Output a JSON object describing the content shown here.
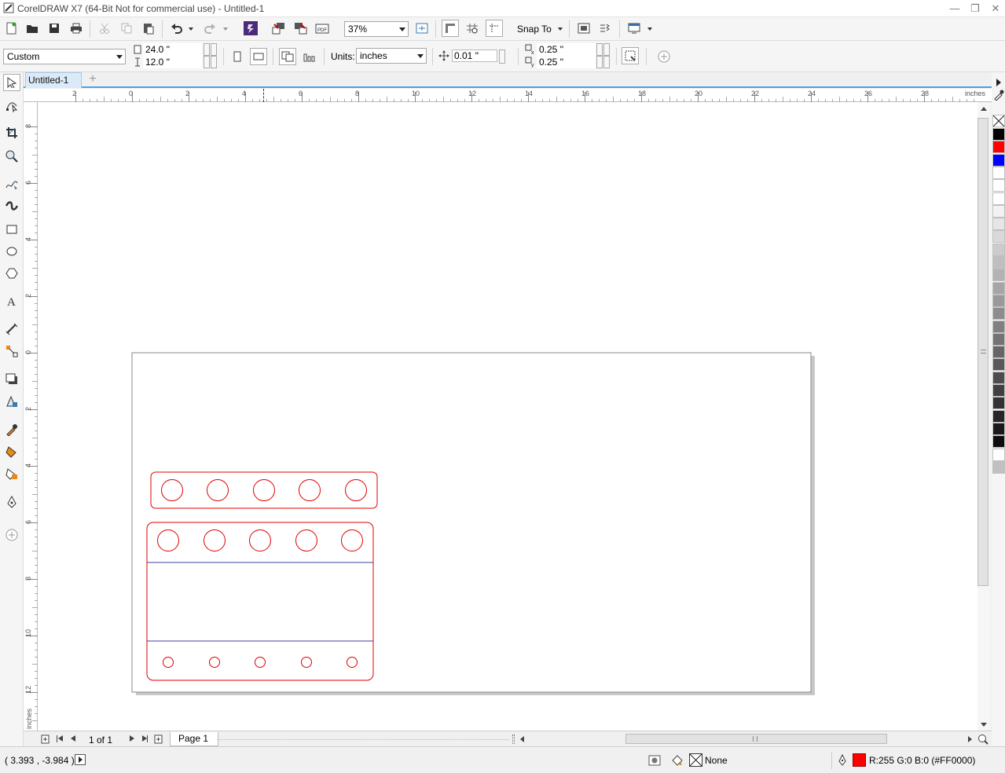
{
  "window": {
    "title": "CorelDRAW X7 (64-Bit Not for commercial use) - Untitled-1"
  },
  "toolbar": {
    "zoom_value": "37%",
    "snap_to_label": "Snap To"
  },
  "property_bar": {
    "page_preset": "Custom",
    "page_width": "24.0 \"",
    "page_height": "12.0 \"",
    "units_label": "Units:",
    "units_value": "inches",
    "nudge_value": "0.01 \"",
    "duplicate_x": "0.25 \"",
    "duplicate_y": "0.25 \""
  },
  "tabs": {
    "active": "Untitled-1"
  },
  "rulers": {
    "unit": "inches",
    "h_ticks": [
      "2",
      "0",
      "2",
      "4",
      "6",
      "8",
      "10",
      "12",
      "14",
      "16",
      "18",
      "20",
      "22",
      "24",
      "26",
      "28"
    ],
    "v_ticks": [
      "8",
      "6",
      "4",
      "2",
      "0",
      "2",
      "4",
      "6",
      "8",
      "10",
      "12"
    ]
  },
  "page_nav": {
    "page_count": "1 of 1",
    "page_tab": "Page 1"
  },
  "status": {
    "cursor_coords": "( 3.393 , -3.984 )",
    "fill_label": "None",
    "outline_color_label": "R:255 G:0 B:0 (#FF0000)"
  },
  "colors": {
    "accent": "#4aa3df",
    "shape_stroke": "#e00000",
    "divider_stroke": "#4040a0",
    "palette": [
      "#000000",
      "#ff0000",
      "#0000ff",
      "#ffffff",
      "#ffffff",
      "#ffffff",
      "#f2f2f2",
      "#e6e6e6",
      "#d9d9d9",
      "#cccccc",
      "#bfbfbf",
      "#b3b3b3",
      "#a6a6a6",
      "#999999",
      "#8c8c8c",
      "#808080",
      "#737373",
      "#666666",
      "#595959",
      "#4d4d4d",
      "#404040",
      "#333333",
      "#262626",
      "#1a1a1a",
      "#0d0d0d",
      "#ffffff",
      "#c0c0c0"
    ]
  },
  "icons": [
    "pick-tool-icon",
    "shape-tool-icon",
    "crop-tool-icon",
    "zoom-tool-icon",
    "freehand-tool-icon",
    "artistic-media-icon",
    "rectangle-tool-icon",
    "ellipse-tool-icon",
    "polygon-tool-icon",
    "text-tool-icon",
    "parallel-dimension-icon",
    "connector-tool-icon",
    "drop-shadow-icon",
    "transparency-tool-icon",
    "color-eyedropper-icon",
    "interactive-fill-icon",
    "smart-fill-icon",
    "outline-pen-icon",
    "add-tool-icon"
  ]
}
